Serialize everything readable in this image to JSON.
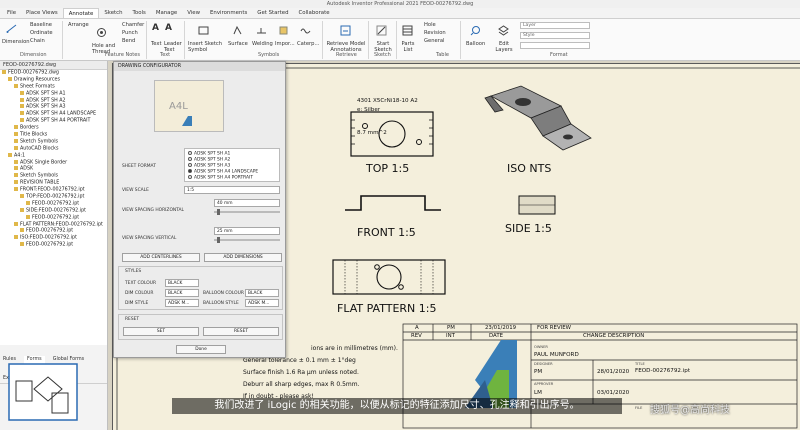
{
  "window": {
    "title": "Autodesk Inventor Professional 2021   FEOD-00276792.dwg"
  },
  "tabs": [
    "File",
    "Place Views",
    "Annotate",
    "Sketch",
    "Tools",
    "Manage",
    "View",
    "Environments",
    "Get Started",
    "Collaborate"
  ],
  "ribbon": {
    "dimension": {
      "items": [
        "Baseline",
        "Ordinate",
        "Chain"
      ],
      "dimension_label": "Dimension",
      "group": "Dimension"
    },
    "feature_notes": {
      "items": [
        "Arrange",
        "Hole and Thread",
        "Chamfer",
        "Punch",
        "Bend"
      ],
      "group": "Feature Notes"
    },
    "text": {
      "items": [
        "Text",
        "Leader Text"
      ],
      "group": "Text"
    },
    "symbols": {
      "items": [
        "Insert Sketch Symbol",
        "Surface",
        "Welding",
        "Impor...",
        "Caterp..."
      ],
      "group": "Symbols"
    },
    "retrieve": {
      "items": [
        "Retrieve Model Annotations"
      ],
      "group": "Retrieve"
    },
    "sketch": {
      "items": [
        "Start Sketch"
      ],
      "group": "Sketch"
    },
    "table": {
      "items": [
        "Parts List",
        "Hole",
        "Revision",
        "General"
      ],
      "group": "Table"
    },
    "balloon": {
      "items": [
        "Balloon",
        "Edit Layers"
      ]
    },
    "format": {
      "layer": "Layer",
      "style": "Style",
      "group": "Format"
    }
  },
  "browser": {
    "file": "FEOD-00276792.dwg",
    "items": [
      "FEOD-00276792.dwg",
      "Drawing Resources",
      "Sheet Formats",
      "ADSK SPT SH A1",
      "ADSK SPT SH A2",
      "ADSK SPT SH A3",
      "ADSK SPT SH A4 LANDSCAPE",
      "ADSK SPT SH A4 PORTRAIT",
      "Borders",
      "Title Blocks",
      "Sketch Symbols",
      "AutoCAD Blocks",
      "A4:1",
      "ADSK Single Border",
      "ADSK",
      "Sketch Symbols",
      "REVISION TABLE",
      "FRONT:FEOD-00276792.ipt",
      "TOP:FEOD-00276792.ipt",
      "FEOD-00276792.ipt",
      "SIDE:FEOD-00276792.ipt",
      "FEOD-00276792.ipt",
      "FLAT PATTERN:FEOD-00276792.ipt",
      "FEOD-00276792.ipt",
      "ISO:FEOD-00276792.ipt",
      "FEOD-00276792.ipt"
    ],
    "bottom_tabs": [
      "Rules",
      "Forms",
      "Global Forms",
      "External Rules"
    ]
  },
  "dialog": {
    "title": "DRAWING CONFIGURATOR",
    "preview_label": "A4L",
    "sheet_format_label": "SHEET FORMAT",
    "sheet_formats": [
      "ADSK SPT SH A1",
      "ADSK SPT SH A2",
      "ADSK SPT SH A3",
      "ADSK SPT SH A4 LANDSCAPE",
      "ADSK SPT SH A4 PORTRAIT"
    ],
    "view_scale_label": "VIEW SCALE",
    "view_scale_value": "1:5",
    "h_spacing_label": "VIEW SPACING HORIZONTAL",
    "h_spacing_value": "40 mm",
    "v_spacing_label": "VIEW SPACING VERTICAL",
    "v_spacing_value": "25 mm",
    "add_centerlines": "ADD CENTERLINES",
    "add_dimensions": "ADD DIMENSIONS",
    "styles_header": "STYLES",
    "text_colour_label": "TEXT COLOUR",
    "text_colour_value": "BLACK",
    "dim_colour_label": "DIM COLOUR",
    "dim_colour_value": "BLACK",
    "balloon_colour_label": "BALLOON COLOUR",
    "balloon_colour_value": "BLACK",
    "dim_style_label": "DIM STYLE",
    "dim_style_value": "ADSK M...",
    "balloon_style_label": "BALLOON STYLE",
    "balloon_style_value": "ADSK M...",
    "reset_header": "RESET",
    "set_button": "SET",
    "reset_button": "RESET",
    "done_button": "Done"
  },
  "drawing": {
    "material_line": "4301 X5CrNi18-10 A2",
    "finish_line": "e: Silber",
    "area_line": "8.7 mm^2",
    "view_top": "TOP 1:5",
    "view_iso": "ISO  NTS",
    "view_front": "FRONT 1:5",
    "view_side": "SIDE 1:5",
    "view_flat": "FLAT PATTERN  1:5",
    "notes": [
      "ions are in millimetres (mm).",
      "General tolerance ± 0.1 mm ± 1°deg",
      "Surface finish 1.6 Ra μm unless noted.",
      "Deburr all sharp edges, max R 0.5mm.",
      "If in doubt - please ask!"
    ],
    "title_block": {
      "rev_row": {
        "rev": "A",
        "by": "PM",
        "date": "23/01/2019",
        "desc": "FOR REVIEW"
      },
      "rev_header": {
        "rev": "REV",
        "by": "INT",
        "date": "DATE",
        "desc": "CHANGE DESCRIPTION"
      },
      "owner_label": "OWNER",
      "owner": "PAUL MUNFORD",
      "designer_label": "DESIGNER",
      "designer": "PM",
      "design_date": "28/01/2020",
      "approver_label": "APPROVER",
      "approver": "LM",
      "approve_date": "03/01/2020",
      "title_label": "TITLE",
      "part_no": "FEOD-00276792.ipt",
      "file_label": "FILE"
    }
  },
  "subtitle": "我们改进了 iLogic 的相关功能，以便从标记的特征添加尺寸、孔注释和引出序号。",
  "watermark": "搜狐号@高尚科技"
}
